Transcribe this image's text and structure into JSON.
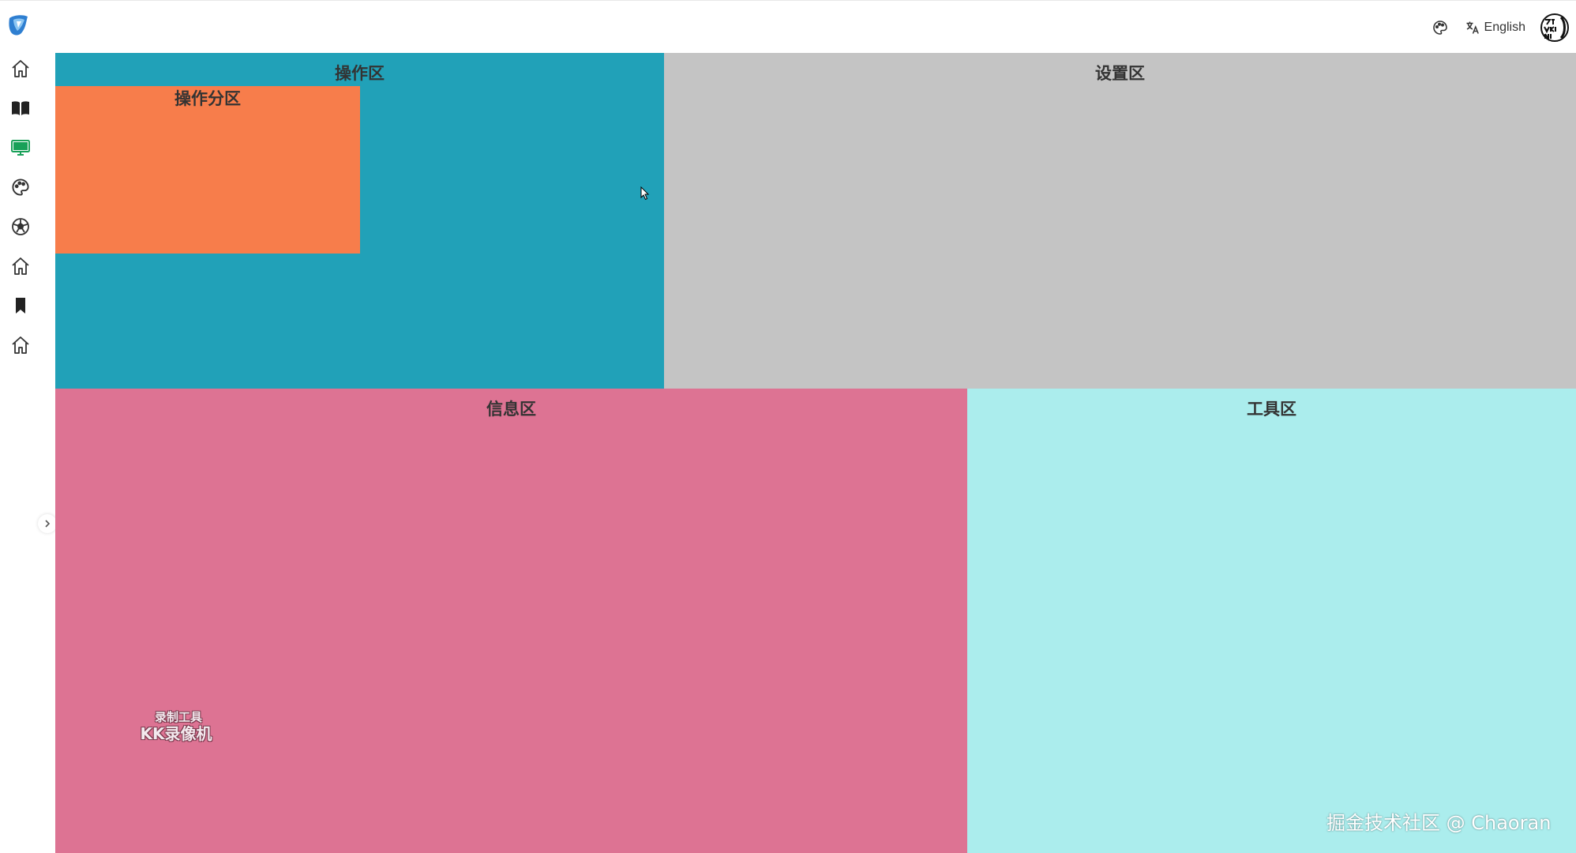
{
  "header": {
    "language_label": "English",
    "icons": [
      "app-logo-icon",
      "palette-icon",
      "translate-icon",
      "avatar-logo"
    ]
  },
  "sidebar": {
    "items": [
      {
        "icon": "home-icon"
      },
      {
        "icon": "book-icon"
      },
      {
        "icon": "monitor-icon",
        "active": true,
        "color": "#18a058"
      },
      {
        "icon": "palette-icon"
      },
      {
        "icon": "soccer-ball-icon"
      },
      {
        "icon": "home-icon"
      },
      {
        "icon": "bookmark-icon"
      },
      {
        "icon": "home-icon"
      }
    ],
    "collapse_icon": "chevron-right-icon"
  },
  "panels": {
    "operation": {
      "title": "操作区",
      "color": "#21a1b8"
    },
    "sub_operation": {
      "title": "操作分区",
      "color": "#f77d4b"
    },
    "settings": {
      "title": "设置区",
      "color": "#c4c4c4"
    },
    "info": {
      "title": "信息区",
      "color": "#dd7393"
    },
    "tools": {
      "title": "工具区",
      "color": "#abeded"
    }
  },
  "overlay": {
    "recorder_line1": "录制工具",
    "recorder_line2": "KK录像机",
    "watermark": "掘金技术社区 @ Chaoran"
  }
}
